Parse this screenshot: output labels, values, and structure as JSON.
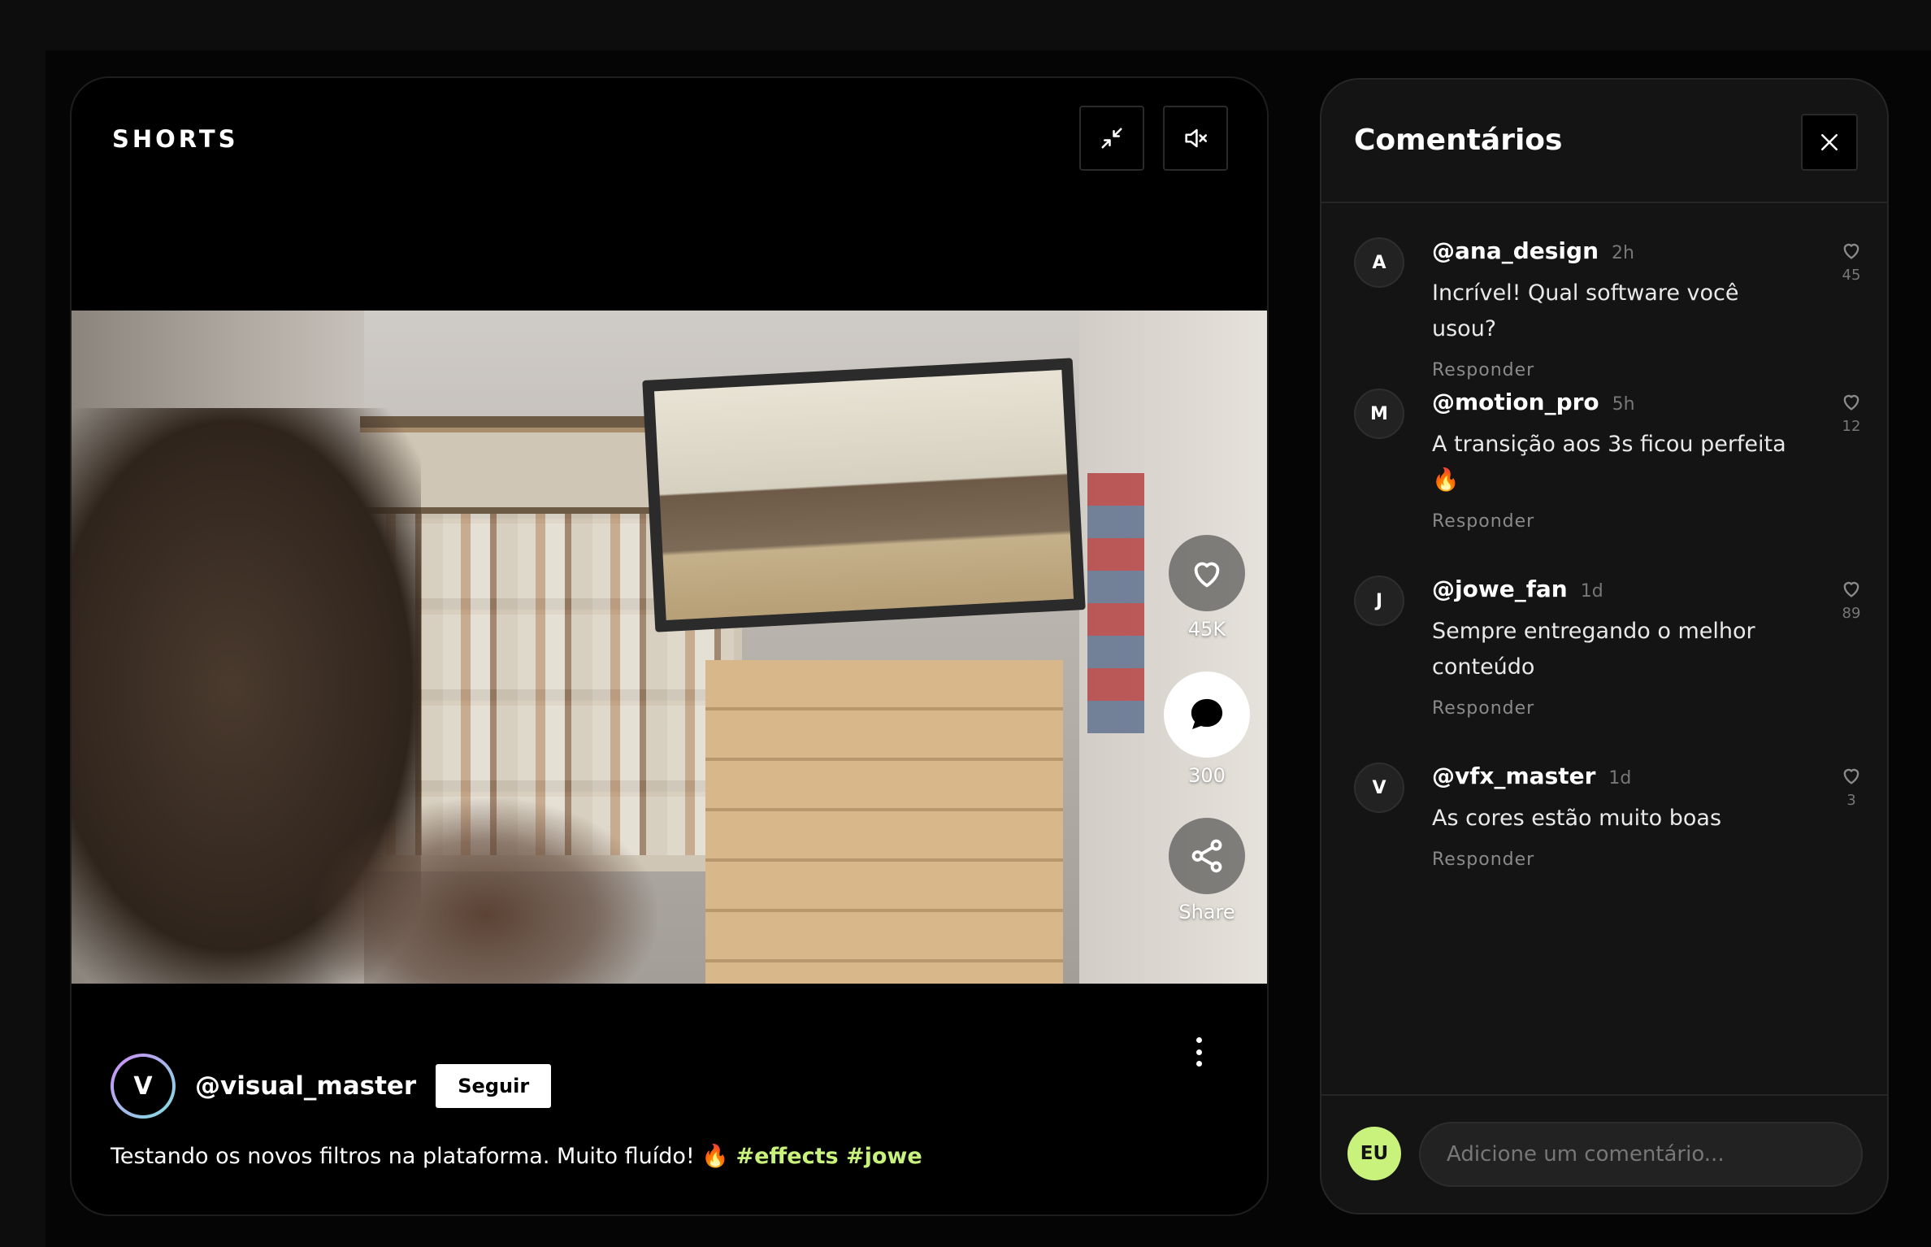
{
  "player": {
    "brand": "SHORTS",
    "controls": {
      "minimize_icon": "minimize-icon",
      "mute_icon": "volume-mute-icon"
    },
    "actions": {
      "like_count": "45K",
      "comment_count": "300",
      "share_label": "Share"
    },
    "author": {
      "initial": "V",
      "handle": "@visual_master",
      "follow_label": "Seguir"
    },
    "caption": {
      "text": "Testando os novos filtros na plataforma. Muito fluído! 🔥",
      "tags": "#effects #jowe"
    }
  },
  "comments_panel": {
    "title": "Comentários",
    "close_icon": "close-icon",
    "reply_label": "Responder",
    "items": [
      {
        "initial": "A",
        "user": "@ana_design",
        "time": "2h",
        "text": "Incrível! Qual software você usou?",
        "likes": "45"
      },
      {
        "initial": "M",
        "user": "@motion_pro",
        "time": "5h",
        "text": "A transição aos 3s ficou perfeita 🔥",
        "likes": "12"
      },
      {
        "initial": "J",
        "user": "@jowe_fan",
        "time": "1d",
        "text": "Sempre entregando o melhor conteúdo",
        "likes": "89"
      },
      {
        "initial": "V",
        "user": "@vfx_master",
        "time": "1d",
        "text": "As cores estão muito boas",
        "likes": "3"
      }
    ],
    "composer": {
      "me_initials": "EU",
      "placeholder": "Adicione um comentário..."
    }
  },
  "colors": {
    "accent": "#c9f27c",
    "background": "#0d0d0d",
    "panel": "#141414"
  }
}
